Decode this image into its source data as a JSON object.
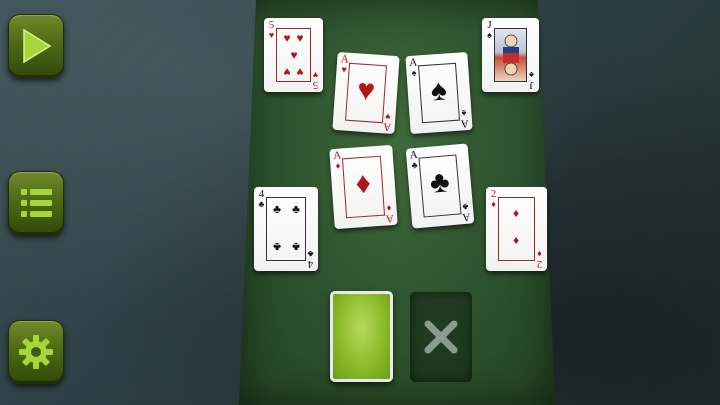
{
  "controls": {
    "play_icon": "play-icon",
    "menu_icon": "list-icon",
    "settings_icon": "gear-icon",
    "accent": "#7fb51f"
  },
  "cards": {
    "five_hearts": {
      "rank": "5",
      "suit": "♥"
    },
    "jack_spades": {
      "rank": "J",
      "suit": "♠"
    },
    "ace_hearts": {
      "rank": "A",
      "suit": "♥"
    },
    "ace_spades": {
      "rank": "A",
      "suit": "♠"
    },
    "ace_diamonds": {
      "rank": "A",
      "suit": "♦"
    },
    "ace_clubs": {
      "rank": "A",
      "suit": "♣"
    },
    "four_clubs": {
      "rank": "4",
      "suit": "♣"
    },
    "two_diamonds": {
      "rank": "2",
      "suit": "♦"
    }
  },
  "slots": {
    "deck": "card-back",
    "discard_icon": "close-icon"
  }
}
